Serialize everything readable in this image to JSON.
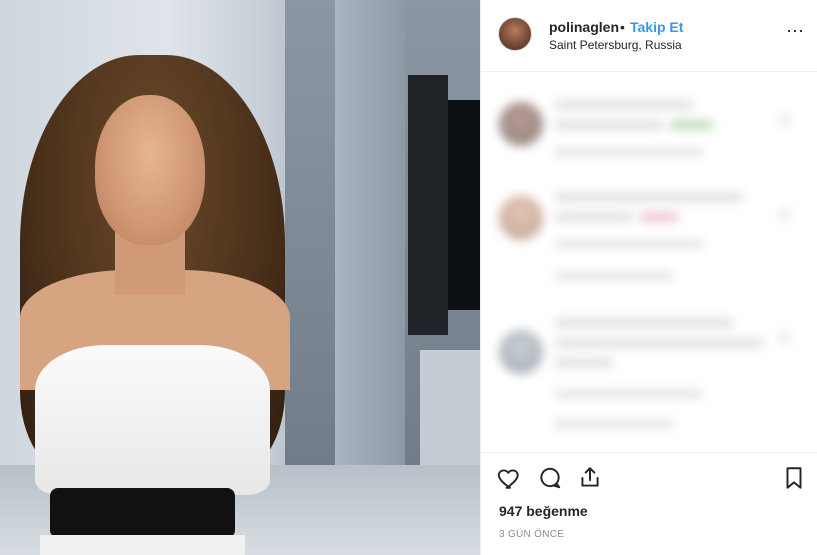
{
  "post": {
    "username": "polinaglen",
    "separator": "•",
    "follow_label": "Takip Et",
    "location": "Saint Petersburg, Russia",
    "more_label": "⋯"
  },
  "actions": {
    "like_icon": "heart-icon",
    "comment_icon": "comment-icon",
    "share_icon": "share-icon",
    "save_icon": "bookmark-icon",
    "likes_text": "947 beğenme",
    "time_text": "3 GÜN ÖNCE"
  },
  "colors": {
    "link_blue": "#3897f0",
    "text_dark": "#262626",
    "text_muted": "#8e8e8e",
    "border": "#efefef"
  }
}
